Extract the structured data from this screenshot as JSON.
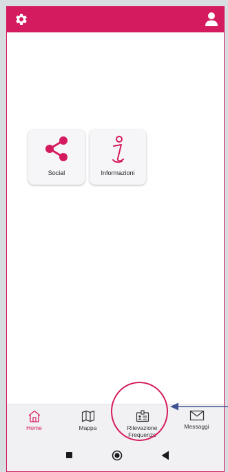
{
  "colors": {
    "brand": "#d51b5f",
    "page_background": "#d8dde2",
    "navbar_background": "#f1f1f4",
    "tile_background": "#f6f6f8",
    "arrow": "#3f5392"
  },
  "header": {
    "left_icon": "gear-icon",
    "right_icon": "user-icon"
  },
  "tiles": [
    {
      "label": "Social",
      "icon": "share-icon"
    },
    {
      "label": "Informazioni",
      "icon": "info-icon"
    }
  ],
  "bottom_nav": {
    "active": "Home",
    "items": [
      {
        "label": "Home",
        "icon": "home-icon"
      },
      {
        "label": "Mappa",
        "icon": "map-icon"
      },
      {
        "label_line1": "Rilevazione",
        "label_line2": "Frequenze",
        "icon": "badge-icon"
      },
      {
        "label": "Messaggi",
        "icon": "mail-icon"
      }
    ]
  },
  "system_nav": {
    "buttons": [
      "recents-icon",
      "home-circle-icon",
      "back-icon"
    ]
  },
  "annotation": {
    "highlight_shape": "ellipse",
    "highlight_target": "Rilevazione Frequenze",
    "pointer_shape": "arrow"
  }
}
